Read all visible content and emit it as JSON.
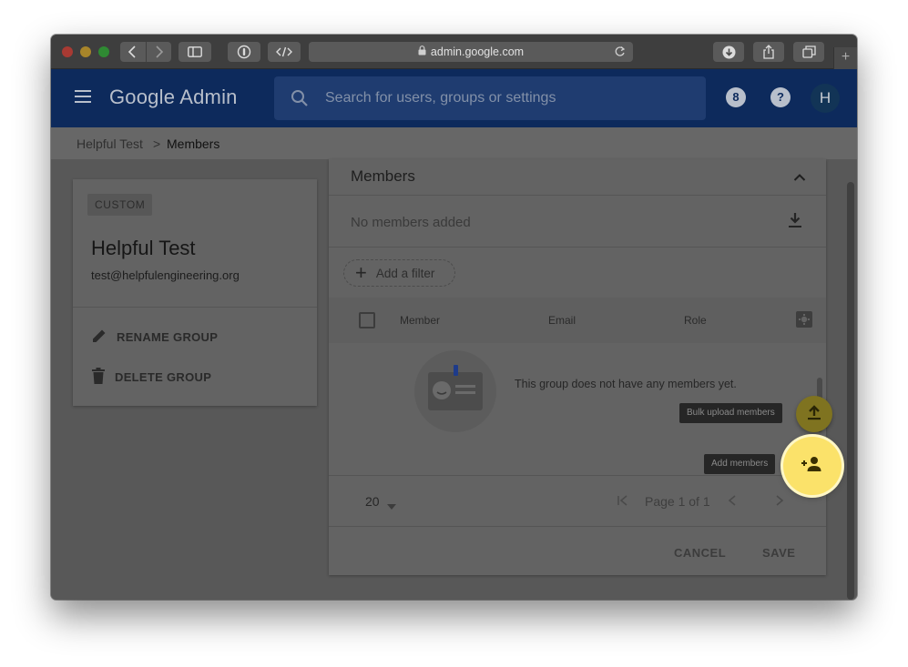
{
  "browser": {
    "url": "admin.google.com"
  },
  "header": {
    "brand": "Google Admin",
    "search_placeholder": "Search for users, groups or settings",
    "notifications_count": "8",
    "help_glyph": "?",
    "avatar_initial": "H"
  },
  "breadcrumb": {
    "parent": "Helpful Test",
    "separator": ">",
    "current": "Members"
  },
  "group": {
    "type_chip": "CUSTOM",
    "name": "Helpful Test",
    "email": "test@helpfulengineering.org",
    "actions": {
      "rename": "RENAME GROUP",
      "delete": "DELETE GROUP"
    }
  },
  "members_panel": {
    "title": "Members",
    "no_members": "No members added",
    "filter_label": "Add a filter",
    "columns": {
      "member": "Member",
      "email": "Email",
      "role": "Role"
    },
    "empty_message": "This group does not have any members yet.",
    "pagination": {
      "page_size": "20",
      "page_text": "Page 1 of 1"
    },
    "cancel_label": "CANCEL",
    "save_label": "SAVE"
  },
  "fabs": {
    "bulk_upload_tooltip": "Bulk upload members",
    "add_members_tooltip": "Add members"
  },
  "colors": {
    "header_bg": "#0d2a5c",
    "fab_highlight": "#fbe26a",
    "overlay_dim": "#585858"
  }
}
